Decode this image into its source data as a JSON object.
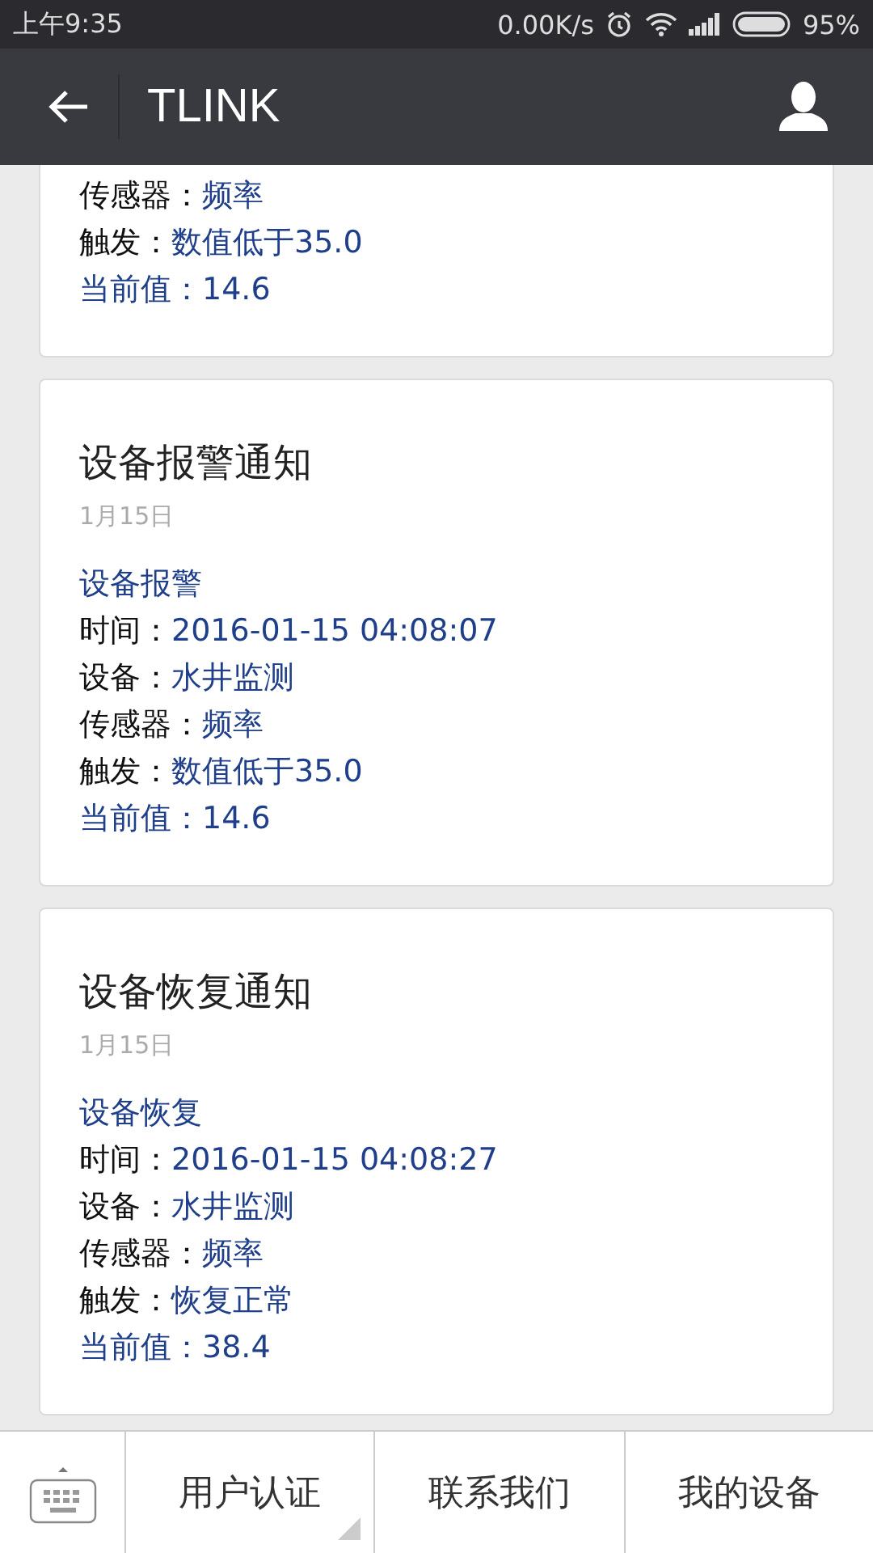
{
  "status_bar": {
    "time": "上午9:35",
    "speed": "0.00K/s",
    "battery": "95%"
  },
  "nav": {
    "title": "TLINK"
  },
  "cards": [
    {
      "fields": [
        {
          "label": "传感器：",
          "value": "频率"
        },
        {
          "label": "触发：",
          "value": "数值低于35.0"
        }
      ],
      "current": {
        "label": "当前值：",
        "value": "14.6"
      }
    },
    {
      "title": "设备报警通知",
      "date": "1月15日",
      "event": "设备报警",
      "fields": [
        {
          "label": "时间：",
          "value": "2016-01-15 04:08:07"
        },
        {
          "label": "设备：",
          "value": "水井监测"
        },
        {
          "label": "传感器：",
          "value": "频率"
        },
        {
          "label": "触发：",
          "value": "数值低于35.0"
        }
      ],
      "current": {
        "label": "当前值：",
        "value": "14.6"
      }
    },
    {
      "title": "设备恢复通知",
      "date": "1月15日",
      "event": "设备恢复",
      "fields": [
        {
          "label": "时间：",
          "value": "2016-01-15 04:08:27"
        },
        {
          "label": "设备：",
          "value": "水井监测"
        },
        {
          "label": "传感器：",
          "value": "频率"
        },
        {
          "label": "触发：",
          "value": "恢复正常"
        }
      ],
      "current": {
        "label": "当前值：",
        "value": "38.4"
      }
    }
  ],
  "menu": [
    {
      "label": "用户认证",
      "has_submenu": true
    },
    {
      "label": "联系我们",
      "has_submenu": false
    },
    {
      "label": "我的设备",
      "has_submenu": false
    }
  ]
}
